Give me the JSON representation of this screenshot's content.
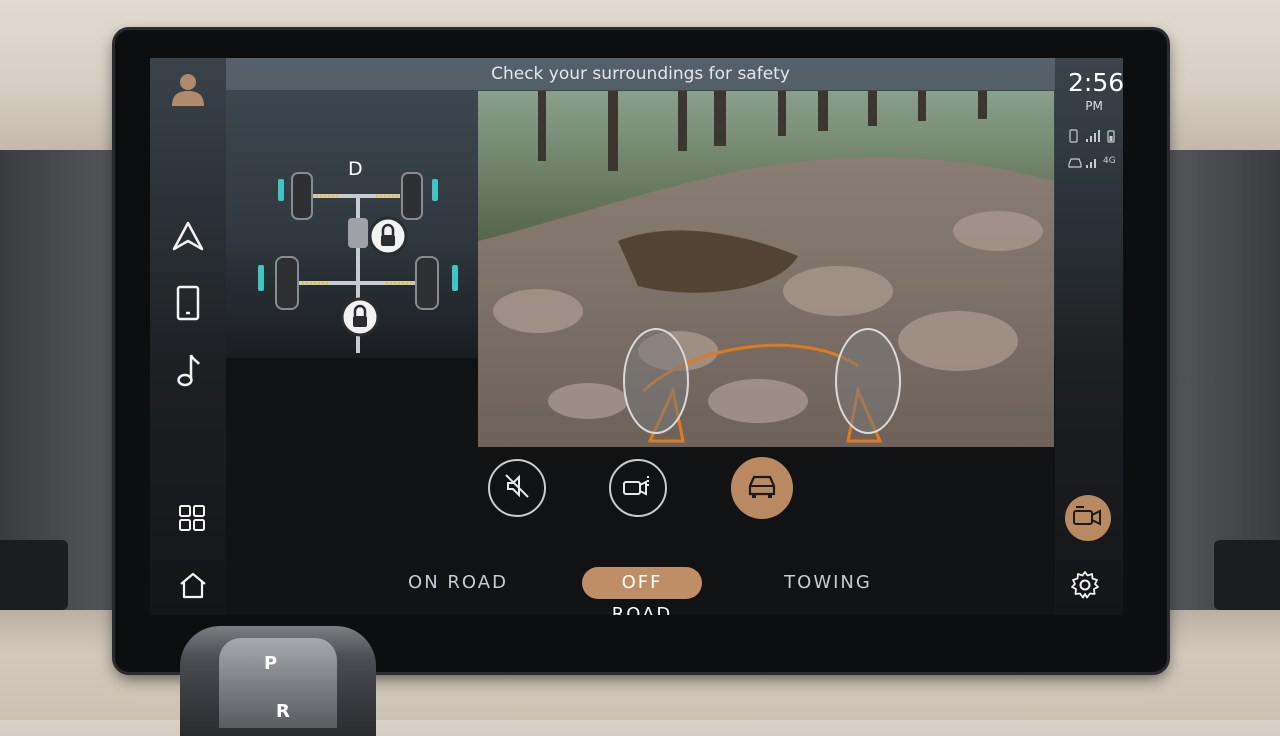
{
  "banner": {
    "text": "Check your surroundings for safety"
  },
  "drivetrain": {
    "gear": "D"
  },
  "status": {
    "time": "2:56",
    "ampm": "PM",
    "network": "4G"
  },
  "modes": [
    {
      "label": "ON ROAD",
      "active": false
    },
    {
      "label": "OFF ROAD",
      "active": true
    },
    {
      "label": "TOWING",
      "active": false
    }
  ],
  "left_rail": [
    "user-icon",
    "navigation-icon",
    "phone-icon",
    "music-icon",
    "apps-grid-icon",
    "home-icon"
  ],
  "camera_controls": [
    "mute-icon",
    "camera-switch-icon",
    "vehicle-view-icon"
  ],
  "shifter": {
    "top_letter": "P",
    "bottom_letter": "R"
  },
  "colors": {
    "accent": "#c08e66",
    "text": "#e3e7ea",
    "screen_bg": "#111214"
  }
}
